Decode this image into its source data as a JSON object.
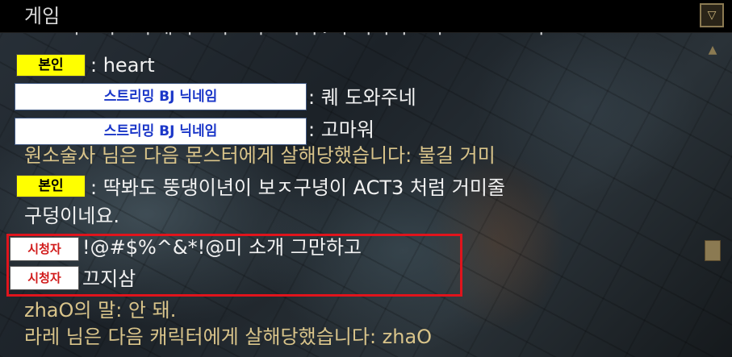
{
  "window": {
    "title": "게임"
  },
  "tags": {
    "self": "본인",
    "streamer": "스트리밍 BJ 닉네임",
    "viewer": "시청자"
  },
  "chat": {
    "ghost_line": "ㅋ ㅡㅓㅁㅓㅡㅓ게 ㅓㄹㅓㅁㅓㅂㅓㅓ. ㅓ ㅓㅓㅓㄹㅓㅂㅡㅡ ㅡ ㅓㅡ",
    "l1": ": heart",
    "l2": ": 퀘 도와주네",
    "l3": ": 고마워",
    "l4": "원소술사 님은 다음 몬스터에게 살해당했습니다: 불길 거미",
    "l5a": ": 딱봐도 뚱댕이년이 보ㅈ구녕이 ACT3 처럼 거미줄",
    "l5b": "구덩이네요.",
    "l6": "!@#$%^&*!@미 소개 그만하고",
    "l7": "끄지삼",
    "l8": "zhaO의 말: 안 돼.",
    "l9": "라레 님은 다음 캐릭터에게 살해당했습니다: zhaO"
  },
  "colors": {
    "system_text": "#d9c48a",
    "chat_text": "#f2f2f2",
    "highlight": "#e0141c"
  }
}
